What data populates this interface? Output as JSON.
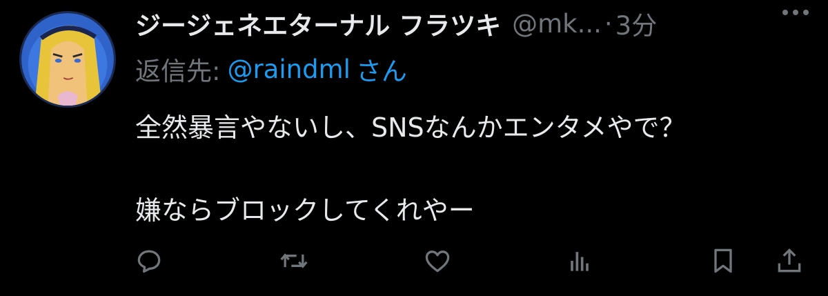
{
  "tweet": {
    "display_name": "ジージェネエターナル フラツキ",
    "handle": "@mk...",
    "separator": "·",
    "time": "3分",
    "reply_prefix": "返信先:",
    "reply_user": "@raindml",
    "reply_suffix": "さん",
    "body_lines": [
      "全然暴言やないし、SNSなんかエンタメやで？",
      "嫌ならブロックしてくれやー"
    ]
  },
  "icons": {
    "more": "more-dots-icon",
    "reply": "reply-icon",
    "retweet": "retweet-icon",
    "like": "like-icon",
    "views": "views-icon",
    "bookmark": "bookmark-icon",
    "share": "share-icon"
  },
  "colors": {
    "background": "#000000",
    "text": "#e7e9ea",
    "secondary": "#71767b",
    "link": "#1d9bf0"
  }
}
